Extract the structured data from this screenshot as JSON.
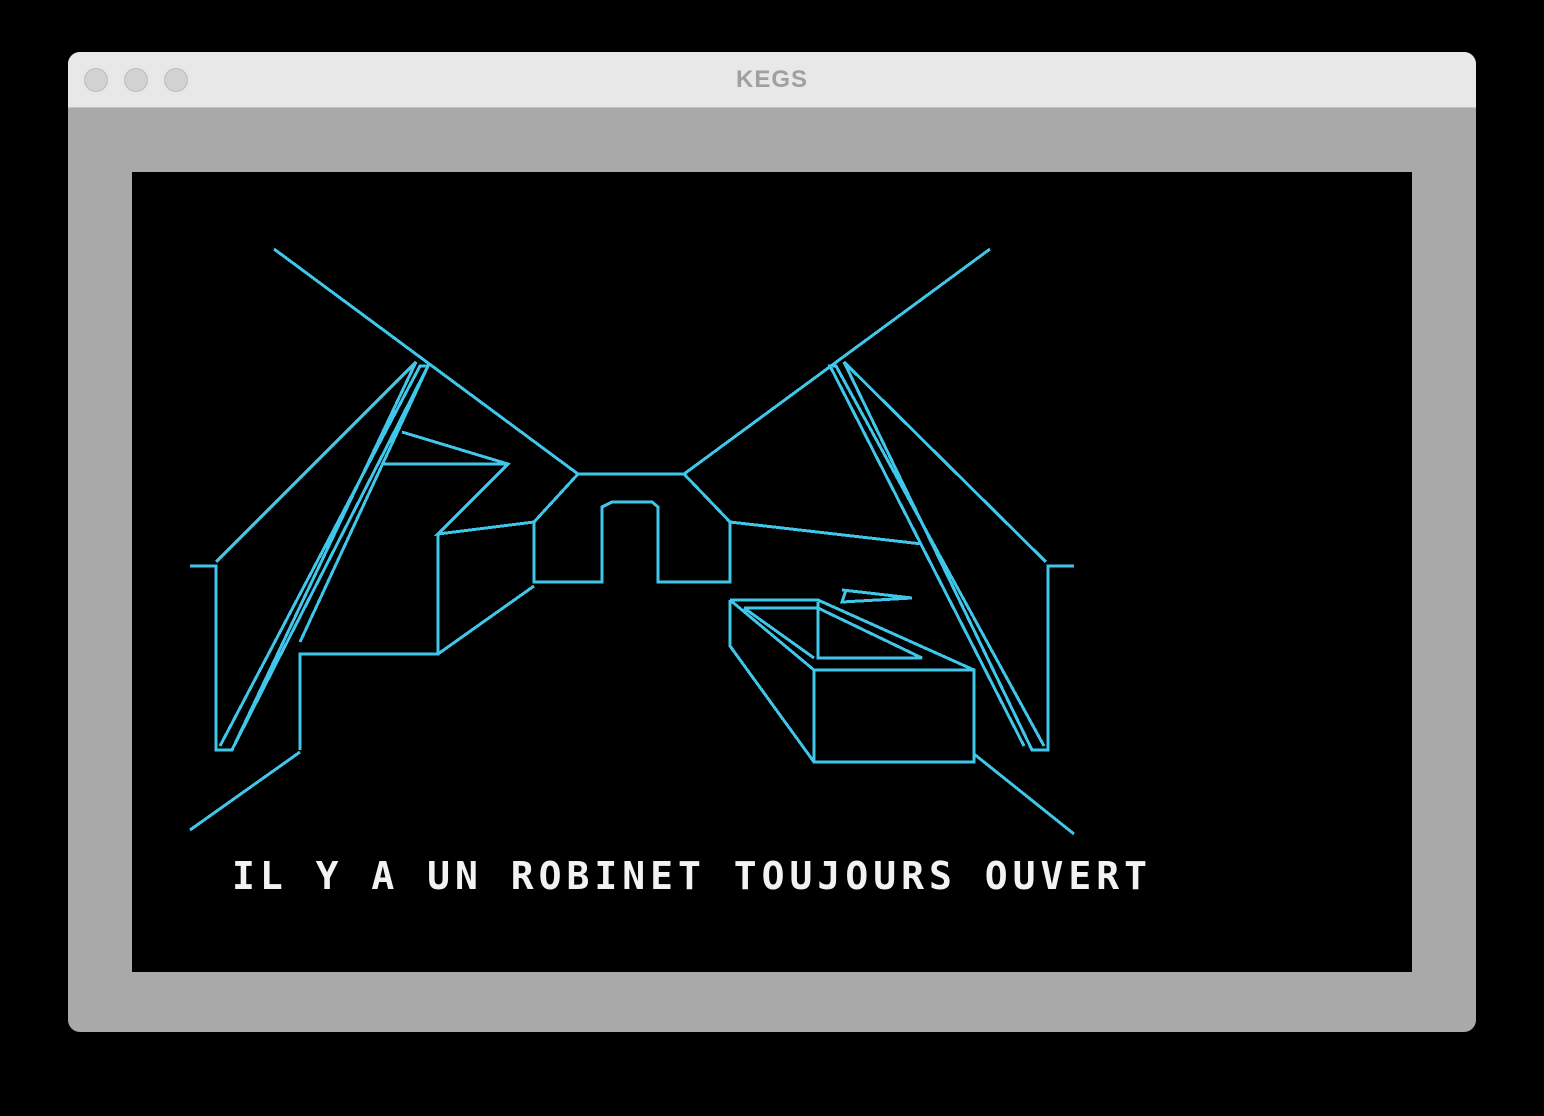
{
  "window": {
    "title": "KEGS"
  },
  "game": {
    "message": "IL Y A UN ROBINET TOUJOURS OUVERT",
    "line_color": "#3fc6e8",
    "text_color": "#f2f2f2",
    "background": "#000000"
  },
  "colors": {
    "window_frame": "#a9a9a9",
    "titlebar": "#e8e8e8",
    "traffic_light_inactive": "#d2d2d2"
  }
}
